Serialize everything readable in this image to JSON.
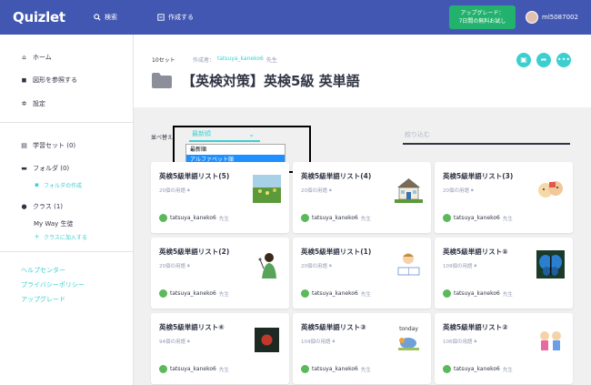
{
  "topbar": {
    "logo": "Quizlet",
    "search_label": "検索",
    "create_label": "作成する",
    "upgrade_line1": "アップグレード：",
    "upgrade_line2": "7日間の無料お試し",
    "username": "ml5087002"
  },
  "sidebar": {
    "home": "ホーム",
    "diagrams": "図形を参照する",
    "settings": "設定",
    "study_sets": "学習セット (0)",
    "folders": "フォルダ (0)",
    "create_folder": "フォルダの作成",
    "classes": "クラス (1)",
    "class_name": "My Way 生徒",
    "join_class": "クラスに加入する",
    "help_center": "ヘルプセンター",
    "privacy_policy": "プライバシーポリシー",
    "upgrade": "アップグレード"
  },
  "header": {
    "set_count": "10セット",
    "creator_prefix": "作成者：",
    "creator_name": "tatsuya_kaneko6",
    "creator_role": "先生",
    "folder_title": "【英検対策】英検5級 英単語"
  },
  "sort": {
    "label": "並べ替え",
    "selected": "最新順",
    "options": [
      "最新順",
      "アルファベット順"
    ]
  },
  "filter": {
    "placeholder": "絞り込む"
  },
  "cards": [
    {
      "title": "英検5級単語リスト(5)",
      "terms": "20個の用語",
      "user": "tatsuya_kaneko6",
      "role": "先生"
    },
    {
      "title": "英検5級単語リスト(4)",
      "terms": "20個の用語",
      "user": "tatsuya_kaneko6",
      "role": "先生"
    },
    {
      "title": "英検5級単語リスト(3)",
      "terms": "20個の用語",
      "user": "tatsuya_kaneko6",
      "role": "先生"
    },
    {
      "title": "英検5級単語リスト(2)",
      "terms": "20個の用語",
      "user": "tatsuya_kaneko6",
      "role": "先生"
    },
    {
      "title": "英検5級単語リスト(1)",
      "terms": "20個の用語",
      "user": "tatsuya_kaneko6",
      "role": "先生"
    },
    {
      "title": "英検5級単語リスト⑤",
      "terms": "109個の用語",
      "user": "tatsuya_kaneko6",
      "role": "先生"
    },
    {
      "title": "英検5級単語リスト④",
      "terms": "94個の用語",
      "user": "tatsuya_kaneko6",
      "role": "先生"
    },
    {
      "title": "英検5級単語リスト③",
      "terms": "104個の用語",
      "user": "tatsuya_kaneko6",
      "role": "先生"
    },
    {
      "title": "英検5級単語リスト②",
      "terms": "106個の用語",
      "user": "tatsuya_kaneko6",
      "role": "先生"
    }
  ],
  "thumb_text": "tonday",
  "colors": {
    "topbar": "#4257b2",
    "accent": "#3ccfcf",
    "upgrade": "#23b26d",
    "highlight": "#1e90ff"
  }
}
